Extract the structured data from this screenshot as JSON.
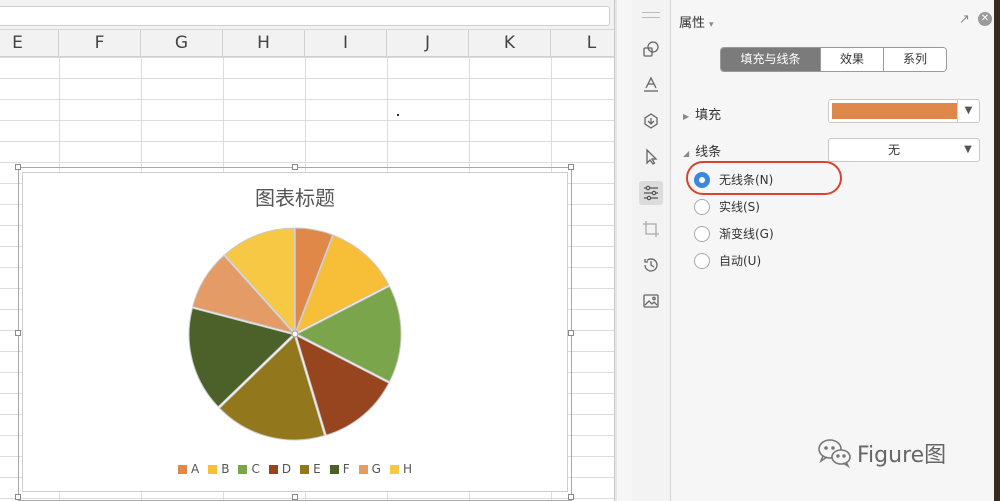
{
  "spreadsheet": {
    "columns": [
      "E",
      "F",
      "G",
      "H",
      "I",
      "J",
      "K",
      "L"
    ]
  },
  "chart": {
    "title": "图表标题"
  },
  "chart_data": {
    "type": "pie",
    "title": "图表标题",
    "categories": [
      "A",
      "B",
      "C",
      "D",
      "E",
      "F",
      "G",
      "H"
    ],
    "values": [
      5,
      10,
      13,
      11,
      15,
      14,
      8,
      10
    ],
    "colors": [
      "#df8848",
      "#f7be37",
      "#7ba54a",
      "#96451f",
      "#92771c",
      "#4b6129",
      "#e49b66",
      "#f7c844"
    ],
    "exploded": true,
    "legend_position": "bottom"
  },
  "toolbar": {
    "icons": [
      "shapes-icon",
      "text-fill-icon",
      "shape-effects-icon",
      "select-arrow-icon",
      "properties-icon",
      "crop-icon",
      "history-icon",
      "image-icon"
    ]
  },
  "panel": {
    "title": "属性",
    "tabs": [
      {
        "label": "填充与线条",
        "active": true
      },
      {
        "label": "效果",
        "active": false
      },
      {
        "label": "系列",
        "active": false
      }
    ],
    "fill": {
      "label": "填充",
      "color": "#e0874a"
    },
    "line": {
      "label": "线条",
      "selected": "无",
      "options": [
        {
          "label": "无线条(N)",
          "checked": true
        },
        {
          "label": "实线(S)",
          "checked": false
        },
        {
          "label": "渐变线(G)",
          "checked": false
        },
        {
          "label": "自动(U)",
          "checked": false
        }
      ]
    }
  },
  "watermark": {
    "text": "Figure图"
  }
}
